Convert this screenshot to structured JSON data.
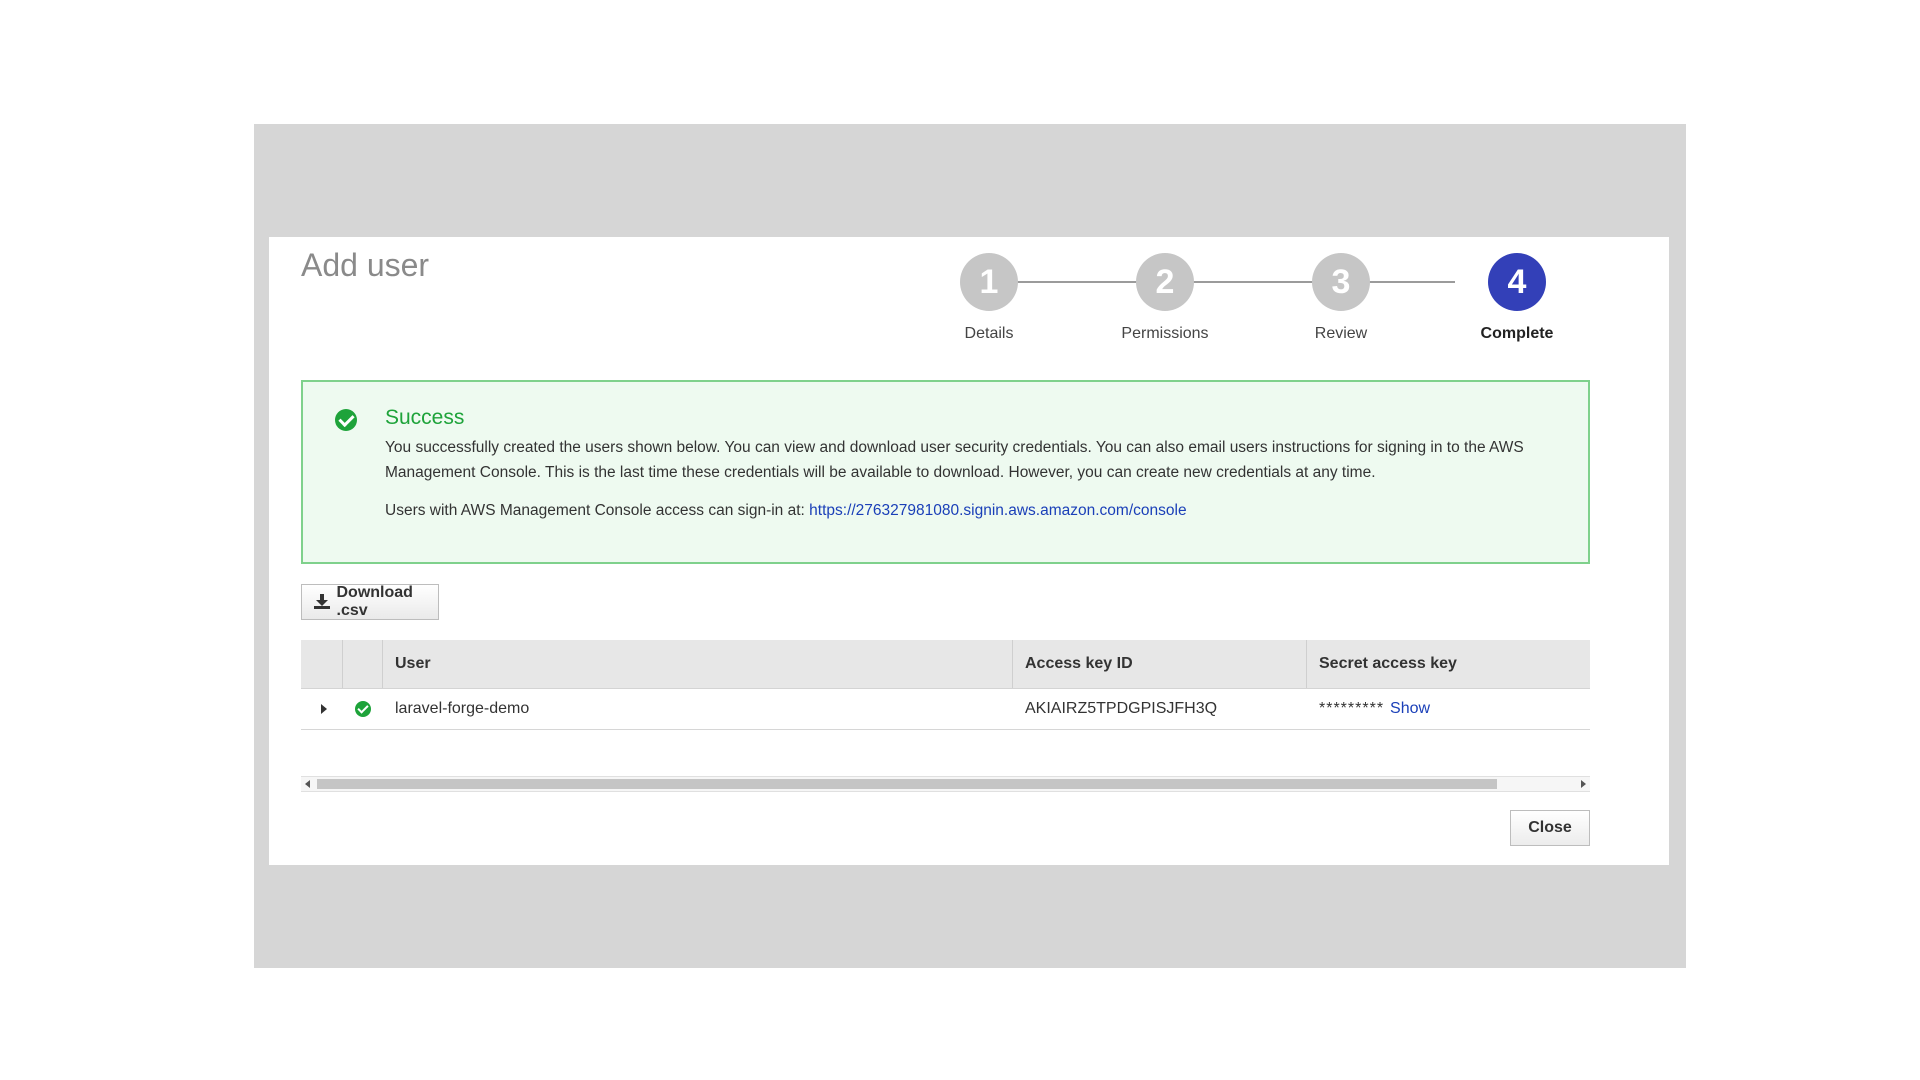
{
  "modal": {
    "title": "Add user"
  },
  "stepper": {
    "steps": [
      {
        "number": "1",
        "label": "Details",
        "active": false
      },
      {
        "number": "2",
        "label": "Permissions",
        "active": false
      },
      {
        "number": "3",
        "label": "Review",
        "active": false
      },
      {
        "number": "4",
        "label": "Complete",
        "active": true
      }
    ],
    "active_color": "#3340b8",
    "inactive_color": "#c6c6c6"
  },
  "alert": {
    "icon": "check-circle-icon",
    "title": "Success",
    "message": "You successfully created the users shown below. You can view and download user security credentials. You can also email users instructions for signing in to the AWS Management Console. This is the last time these credentials will be available to download. However, you can create new credentials at any time.",
    "signin_prefix": "Users with AWS Management Console access can sign-in at:",
    "signin_link": "https://276327981080.signin.aws.amazon.com/console",
    "success_color": "#1ea33a"
  },
  "toolbar": {
    "download_icon": "download-icon",
    "download_label": "Download .csv"
  },
  "table": {
    "headers": {
      "user": "User",
      "access_key_id": "Access key ID",
      "secret_access_key": "Secret access key"
    },
    "rows": [
      {
        "user": "laravel-forge-demo",
        "access_key_id": "AKIAIRZ5TPDGPISJFH3Q",
        "secret_masked": "*********",
        "show_label": "Show"
      }
    ]
  },
  "footer": {
    "close_label": "Close"
  }
}
